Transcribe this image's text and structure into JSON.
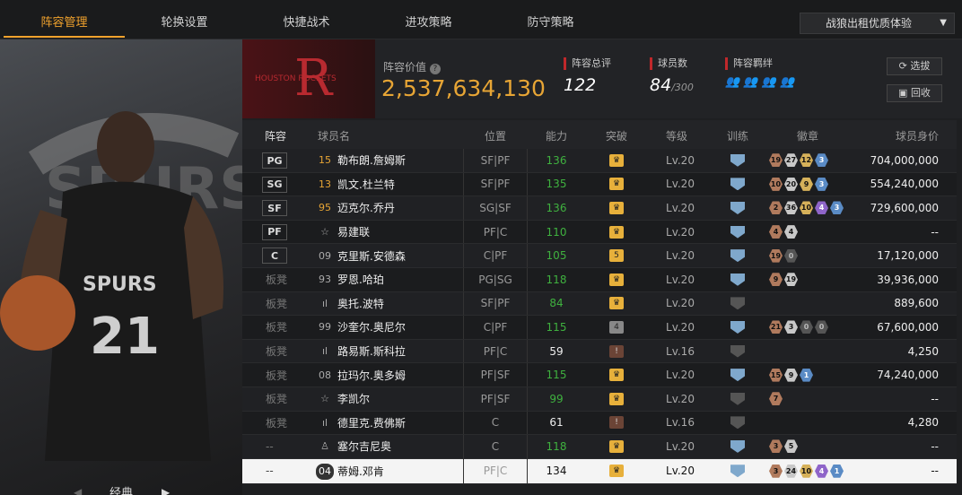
{
  "tabs": [
    "阵容管理",
    "轮换设置",
    "快捷战术",
    "进攻策略",
    "防守策略"
  ],
  "dropdown": {
    "value": "战狼出租优质体验"
  },
  "left": {
    "mode_label": "经典"
  },
  "summary": {
    "value_label": "阵容价值",
    "value": "2,537,634,130",
    "overall_label": "阵容总评",
    "overall": "122",
    "players_label": "球员数",
    "players": "84",
    "players_max": "/300",
    "chem_label": "阵容羁绊",
    "btn_select": "选拔",
    "btn_recycle": "回收",
    "team_logo_text": "HOUSTON ROCKETS"
  },
  "headers": [
    "阵容",
    "球员名",
    "位置",
    "能力",
    "突破",
    "等级",
    "训练",
    "徽章",
    "球员身价"
  ],
  "rows": [
    {
      "role": "PG",
      "num": "15",
      "gold": true,
      "name": "勒布朗.詹姆斯",
      "pos": "SF|PF",
      "abil": "136",
      "green": true,
      "tp": "",
      "tpc": "gold",
      "lv": "Lv.20",
      "train": "blue",
      "badges": [
        [
          "b",
          "19"
        ],
        [
          "s",
          "27"
        ],
        [
          "g",
          "12"
        ],
        [
          "t",
          "3"
        ]
      ],
      "price": "704,000,000"
    },
    {
      "role": "SG",
      "num": "13",
      "gold": true,
      "name": "凯文.杜兰特",
      "pos": "SF|PF",
      "abil": "135",
      "green": true,
      "tp": "",
      "tpc": "gold",
      "lv": "Lv.20",
      "train": "blue",
      "badges": [
        [
          "b",
          "10"
        ],
        [
          "s",
          "20"
        ],
        [
          "g",
          "9"
        ],
        [
          "t",
          "3"
        ]
      ],
      "price": "554,240,000"
    },
    {
      "role": "SF",
      "num": "95",
      "gold": true,
      "name": "迈克尔.乔丹",
      "pos": "SG|SF",
      "abil": "136",
      "green": true,
      "tp": "",
      "tpc": "gold",
      "lv": "Lv.20",
      "train": "blue",
      "badges": [
        [
          "b",
          "2"
        ],
        [
          "s",
          "36"
        ],
        [
          "g",
          "10"
        ],
        [
          "p",
          "4"
        ],
        [
          "t",
          "3"
        ]
      ],
      "price": "729,600,000"
    },
    {
      "role": "PF",
      "num": "☆",
      "gold": false,
      "name": "易建联",
      "pos": "PF|C",
      "abil": "110",
      "green": true,
      "tp": "",
      "tpc": "gold",
      "lv": "Lv.20",
      "train": "blue",
      "badges": [
        [
          "b",
          "4"
        ],
        [
          "s",
          "4"
        ]
      ],
      "price": "--"
    },
    {
      "role": "C",
      "num": "09",
      "gold": false,
      "name": "克里斯.安德森",
      "pos": "C|PF",
      "abil": "105",
      "green": true,
      "tp": "5",
      "tpc": "gold",
      "lv": "Lv.20",
      "train": "blue",
      "badges": [
        [
          "b",
          "19"
        ],
        [
          "d",
          "0"
        ]
      ],
      "price": "17,120,000"
    },
    {
      "role": "板凳",
      "num": "93",
      "gold": false,
      "name": "罗恩.哈珀",
      "pos": "PG|SG",
      "abil": "118",
      "green": true,
      "tp": "",
      "tpc": "gold",
      "lv": "Lv.20",
      "train": "blue",
      "badges": [
        [
          "b",
          "9"
        ],
        [
          "s",
          "19"
        ]
      ],
      "price": "39,936,000"
    },
    {
      "role": "板凳",
      "num": "ıl",
      "gold": false,
      "name": "奥托.波特",
      "pos": "SF|PF",
      "abil": "84",
      "green": true,
      "tp": "",
      "tpc": "gold",
      "lv": "Lv.20",
      "train": "gray",
      "badges": [],
      "price": "889,600"
    },
    {
      "role": "板凳",
      "num": "99",
      "gold": false,
      "name": "沙奎尔.奥尼尔",
      "pos": "C|PF",
      "abil": "115",
      "green": true,
      "tp": "4",
      "tpc": "gray",
      "lv": "Lv.20",
      "train": "blue",
      "badges": [
        [
          "b",
          "21"
        ],
        [
          "s",
          "3"
        ],
        [
          "d",
          "0"
        ],
        [
          "d",
          "0"
        ]
      ],
      "price": "67,600,000"
    },
    {
      "role": "板凳",
      "num": "ıl",
      "gold": false,
      "name": "路易斯.斯科拉",
      "pos": "PF|C",
      "abil": "59",
      "green": false,
      "tp": "!",
      "tpc": "brown",
      "lv": "Lv.16",
      "train": "gray",
      "badges": [],
      "price": "4,250"
    },
    {
      "role": "板凳",
      "num": "08",
      "gold": false,
      "name": "拉玛尔.奥多姆",
      "pos": "PF|SF",
      "abil": "115",
      "green": true,
      "tp": "",
      "tpc": "gold",
      "lv": "Lv.20",
      "train": "blue",
      "badges": [
        [
          "b",
          "15"
        ],
        [
          "s",
          "9"
        ],
        [
          "t",
          "1"
        ]
      ],
      "price": "74,240,000"
    },
    {
      "role": "板凳",
      "num": "☆",
      "gold": false,
      "name": "李凯尔",
      "pos": "PF|SF",
      "abil": "99",
      "green": true,
      "tp": "",
      "tpc": "gold",
      "lv": "Lv.20",
      "train": "gray",
      "badges": [
        [
          "b",
          "7"
        ]
      ],
      "price": "--"
    },
    {
      "role": "板凳",
      "num": "ıl",
      "gold": false,
      "name": "德里克.费佛斯",
      "pos": "C",
      "abil": "61",
      "green": false,
      "tp": "!",
      "tpc": "brown",
      "lv": "Lv.16",
      "train": "gray",
      "badges": [],
      "price": "4,280"
    },
    {
      "role": "--",
      "num": "♙",
      "gold": false,
      "name": "塞尔吉尼奥",
      "pos": "C",
      "abil": "118",
      "green": true,
      "tp": "",
      "tpc": "gold",
      "lv": "Lv.20",
      "train": "blue",
      "badges": [
        [
          "b",
          "3"
        ],
        [
          "s",
          "5"
        ]
      ],
      "price": "--"
    },
    {
      "role": "--",
      "num": "04",
      "gold": false,
      "name": "蒂姆.邓肯",
      "pos": "PF|C",
      "abil": "134",
      "green": false,
      "tp": "",
      "tpc": "gold",
      "lv": "Lv.20",
      "train": "blue",
      "badges": [
        [
          "b",
          "3"
        ],
        [
          "s",
          "24"
        ],
        [
          "g",
          "10"
        ],
        [
          "p",
          "4"
        ],
        [
          "t",
          "1"
        ]
      ],
      "price": "--",
      "selected": true
    }
  ]
}
